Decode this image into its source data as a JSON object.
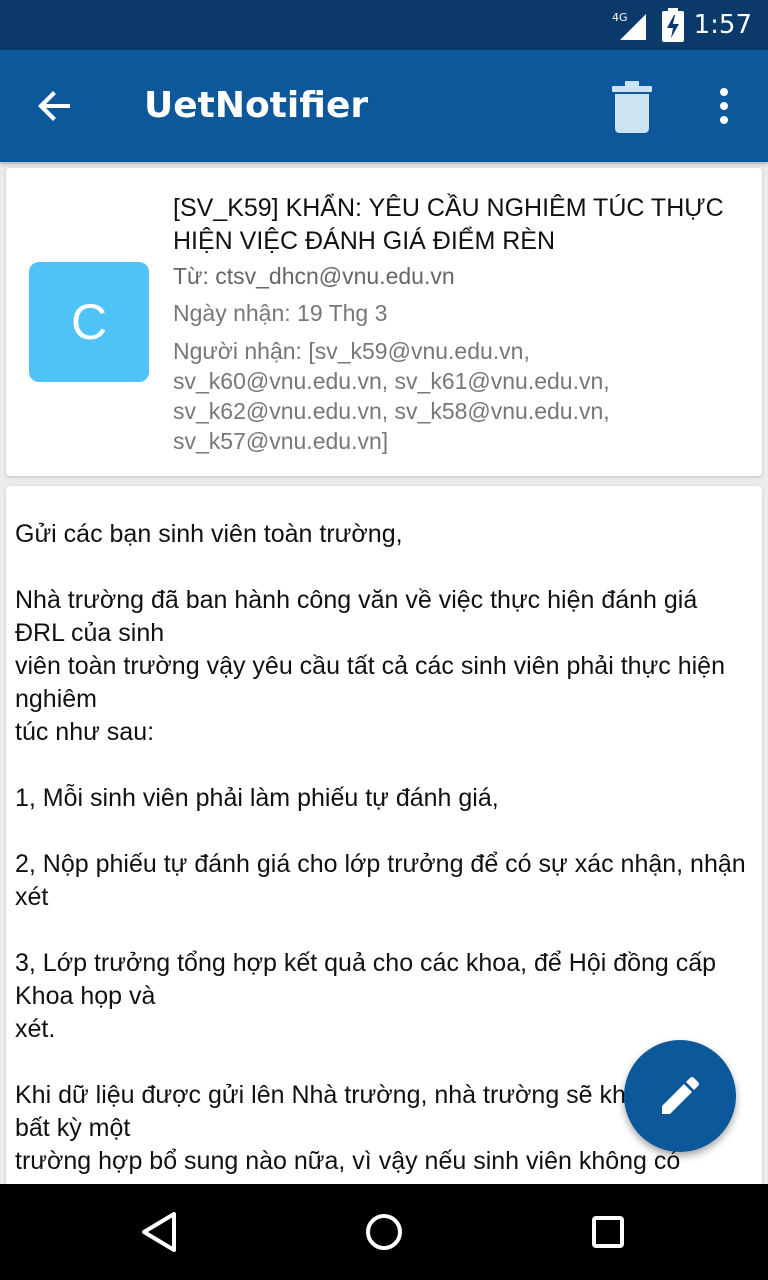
{
  "status_bar": {
    "time": "1:57",
    "network": "4G"
  },
  "app_bar": {
    "title": "UetNotifier",
    "icons": [
      "back-arrow-icon",
      "trash-icon",
      "more-vert-icon"
    ]
  },
  "message": {
    "avatar_letter": "C",
    "subject": "[SV_K59] KHẨN: YÊU CẦU NGHIÊM TÚC THỰC HIỆN VIỆC ĐÁNH GIÁ ĐIỂM RÈN",
    "from": "Từ: ctsv_dhcn@vnu.edu.vn",
    "date": "Ngày nhận: 19 Thg 3",
    "recipients": "Người nhận: [sv_k59@vnu.edu.vn, sv_k60@vnu.edu.vn, sv_k61@vnu.edu.vn, sv_k62@vnu.edu.vn, sv_k58@vnu.edu.vn, sv_k57@vnu.edu.vn]",
    "body": "Gửi các bạn sinh viên toàn trường,\n\nNhà trường đã ban hành công văn về việc thực hiện đánh giá ĐRL của sinh\nviên toàn trường vậy yêu cầu tất cả các sinh viên phải thực hiện nghiêm\ntúc như sau:\n\n1, Mỗi sinh viên phải làm phiếu tự đánh giá,\n\n2, Nộp phiếu tự đánh giá cho lớp trưởng để có sự xác nhận, nhận xét\n\n3, Lớp trưởng tổng hợp kết quả cho các khoa, để Hội đồng cấp Khoa họp và\nxét.\n\nKhi dữ liệu được gửi lên Nhà trường, nhà trường sẽ không nhận bất kỳ một\ntrường hợp bổ sung nào nữa, vì vậy nếu sinh viên không có"
  },
  "colors": {
    "status_bar": "#0b3a6a",
    "app_bar": "#0d579b",
    "avatar": "#4fc3f7",
    "fab": "#0d579b"
  },
  "fab": {
    "icon": "edit-pencil-icon"
  },
  "nav_bar": {
    "icons": [
      "nav-back-icon",
      "nav-home-icon",
      "nav-recents-icon"
    ]
  }
}
